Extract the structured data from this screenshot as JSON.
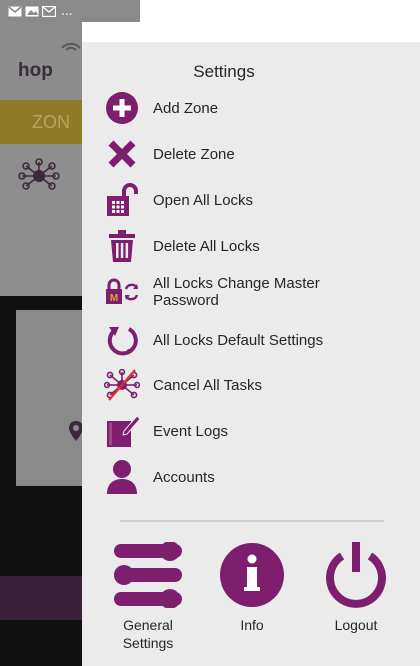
{
  "status_bar": {
    "icons": [
      "gmail-icon",
      "image-icon",
      "mail-icon"
    ],
    "more": "..."
  },
  "background_app": {
    "logo_text": "hop",
    "zone_tab": "ZON"
  },
  "drawer": {
    "title": "Settings",
    "items": [
      {
        "label": "Add Zone",
        "icon": "add-circle-icon"
      },
      {
        "label": "Delete Zone",
        "icon": "close-x-icon"
      },
      {
        "label": "Open All Locks",
        "icon": "unlocked-padlock-icon"
      },
      {
        "label": "Delete All Locks",
        "icon": "trash-icon"
      },
      {
        "label": "All Locks Change Master Password",
        "icon": "master-lock-refresh-icon"
      },
      {
        "label": "All Locks Default Settings",
        "icon": "restore-icon"
      },
      {
        "label": "Cancel All Tasks",
        "icon": "cancel-network-icon"
      },
      {
        "label": "Event Logs",
        "icon": "notebook-icon"
      },
      {
        "label": "Accounts",
        "icon": "user-icon"
      }
    ],
    "bottom": {
      "general_settings": "General\nSettings",
      "info": "Info",
      "logout": "Logout"
    }
  },
  "colors": {
    "accent": "#7d1f6e",
    "drawer_bg": "#ebebeb",
    "cancel_red": "#e0302a",
    "zone_bar": "#8f7a28"
  }
}
